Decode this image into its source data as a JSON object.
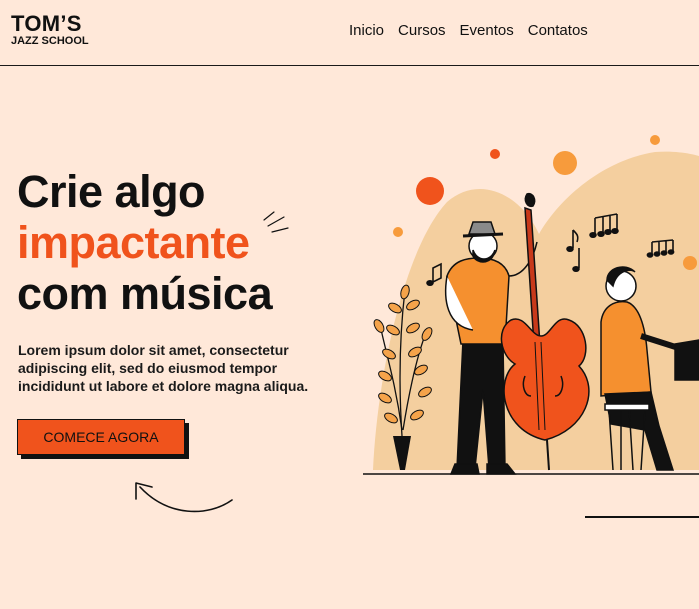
{
  "brand": {
    "name": "TOM’S",
    "sub": "JAZZ SCHOOL"
  },
  "nav": {
    "items": [
      "Inicio",
      "Cursos",
      "Eventos",
      "Contatos"
    ]
  },
  "hero": {
    "title_line1": "Crie algo",
    "title_line2": "impactante",
    "title_line3": "com música",
    "description": "Lorem ipsum dolor sit amet, consectetur adipiscing elit, sed do eiusmod tempor incididunt ut labore et dolore magna aliqua.",
    "cta_label": "COMECE AGORA"
  },
  "colors": {
    "background": "#ffe8d9",
    "accent": "#f0531c",
    "blob": "#f4cf9f",
    "text": "#111111"
  }
}
